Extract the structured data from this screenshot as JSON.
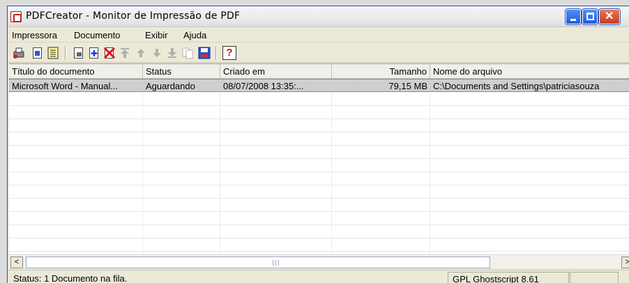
{
  "window": {
    "title": "PDFCreator - Monitor de Impressão de PDF",
    "controls": {
      "minimize": "_",
      "maximize": "□",
      "close": "✕"
    }
  },
  "menubar": {
    "items": [
      "Impressora",
      "Documento",
      "Exibir",
      "Ajuda"
    ]
  },
  "toolbar": {
    "icons": [
      "printer-icon",
      "document-properties-icon",
      "log-icon",
      "print-document-icon",
      "add-document-icon",
      "delete-document-icon",
      "move-top-icon",
      "move-up-icon",
      "move-down-icon",
      "move-bottom-icon",
      "combine-icon",
      "save-icon",
      "help-icon"
    ],
    "help_glyph": "?"
  },
  "table": {
    "columns": [
      "Título do documento",
      "Status",
      "Criado em",
      "Tamanho",
      "Nome do arquivo"
    ],
    "rows": [
      [
        "Microsoft Word - Manual...",
        "Aguardando",
        "08/07/2008 13:35:...",
        "79,15 MB",
        "C:\\Documents and Settings\\patriciasouza"
      ]
    ]
  },
  "scrollbar": {
    "left_arrow": "<",
    "right_arrow": ">",
    "grip": "III"
  },
  "statusbar": {
    "status_text": "Status: 1 Documento na fila.",
    "ghostscript": "GPL Ghostscript 8.61",
    "extra_panel": ""
  },
  "colors": {
    "titlebar": "#ececec",
    "window_frame": "#2a4cb5",
    "selected_row": "#cfcfcf",
    "close_button": "#c6401f"
  }
}
